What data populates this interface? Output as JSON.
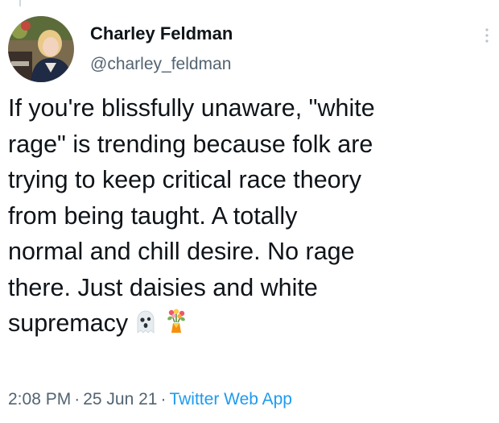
{
  "tweet": {
    "author": {
      "name": "Charley Feldman",
      "handle": "@charley_feldman"
    },
    "text_lines": [
      "If you're blissfully unaware, \"white",
      "rage\" is trending because folk are",
      "trying to keep critical race theory",
      "from being taught. A totally",
      "normal and chill desire. No rage",
      "there. Just daisies and white",
      "supremacy"
    ],
    "emojis": [
      "ghost-icon",
      "bouquet-icon"
    ],
    "time": "2:08 PM",
    "separator": "·",
    "date": "25 Jun 21",
    "source": "Twitter Web App"
  },
  "colors": {
    "text": "#0f1419",
    "secondary": "#536471",
    "link": "#1d9bf0"
  }
}
